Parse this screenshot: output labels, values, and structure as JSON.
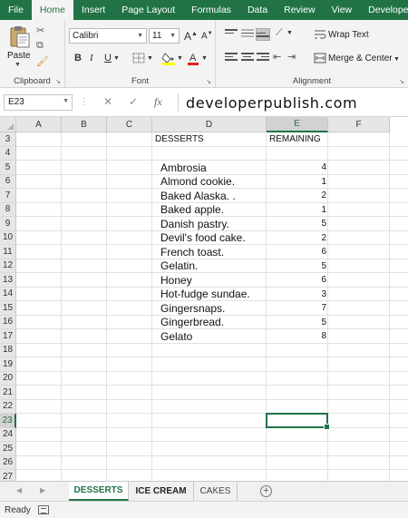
{
  "ribbon": {
    "tabs": [
      "File",
      "Home",
      "Insert",
      "Page Layout",
      "Formulas",
      "Data",
      "Review",
      "View",
      "Developer"
    ],
    "active_tab": "Home",
    "clipboard": {
      "label": "Clipboard",
      "paste_label": "Paste"
    },
    "font": {
      "label": "Font",
      "font_name": "Calibri",
      "font_size": "11",
      "bold": "B",
      "italic": "I",
      "underline": "U",
      "grow": "A",
      "shrink": "A"
    },
    "alignment": {
      "label": "Alignment",
      "wrap_text": "Wrap Text",
      "merge_center": "Merge & Center"
    }
  },
  "formula_bar": {
    "name_box": "E23",
    "formula_text": "developerpublish.com"
  },
  "grid": {
    "columns": [
      "A",
      "B",
      "C",
      "D",
      "E",
      "F"
    ],
    "rows": [
      "3",
      "4",
      "5",
      "6",
      "7",
      "8",
      "9",
      "10",
      "11",
      "12",
      "13",
      "14",
      "15",
      "16",
      "17",
      "18",
      "19",
      "20",
      "21",
      "22",
      "23",
      "24",
      "25",
      "26",
      "27"
    ],
    "selected_row": "23",
    "selected_col": "E",
    "header_desserts": "DESSERTS",
    "header_remaining": "REMAINING",
    "items": [
      {
        "name": "Ambrosia",
        "remaining": "4"
      },
      {
        "name": "Almond cookie.",
        "remaining": "1"
      },
      {
        "name": "Baked Alaska. .",
        "remaining": "2"
      },
      {
        "name": "Baked apple.",
        "remaining": "1"
      },
      {
        "name": "Danish pastry.",
        "remaining": "5"
      },
      {
        "name": "Devil's food cake.",
        "remaining": "2"
      },
      {
        "name": "French toast.",
        "remaining": "6"
      },
      {
        "name": "Gelatin.",
        "remaining": "5"
      },
      {
        "name": "Honey",
        "remaining": "6"
      },
      {
        "name": "Hot-fudge sundae.",
        "remaining": "3"
      },
      {
        "name": "Gingersnaps.",
        "remaining": "7"
      },
      {
        "name": "Gingerbread.",
        "remaining": "5"
      },
      {
        "name": "Gelato",
        "remaining": "8"
      }
    ]
  },
  "sheets": {
    "tabs": [
      "DESSERTS",
      "ICE CREAM",
      "CAKES"
    ],
    "active": "DESSERTS"
  },
  "status": {
    "text": "Ready"
  },
  "colors": {
    "accent": "#217346",
    "ribbon_bg": "#f3f3f3",
    "header_bg": "#e6e6e6"
  }
}
